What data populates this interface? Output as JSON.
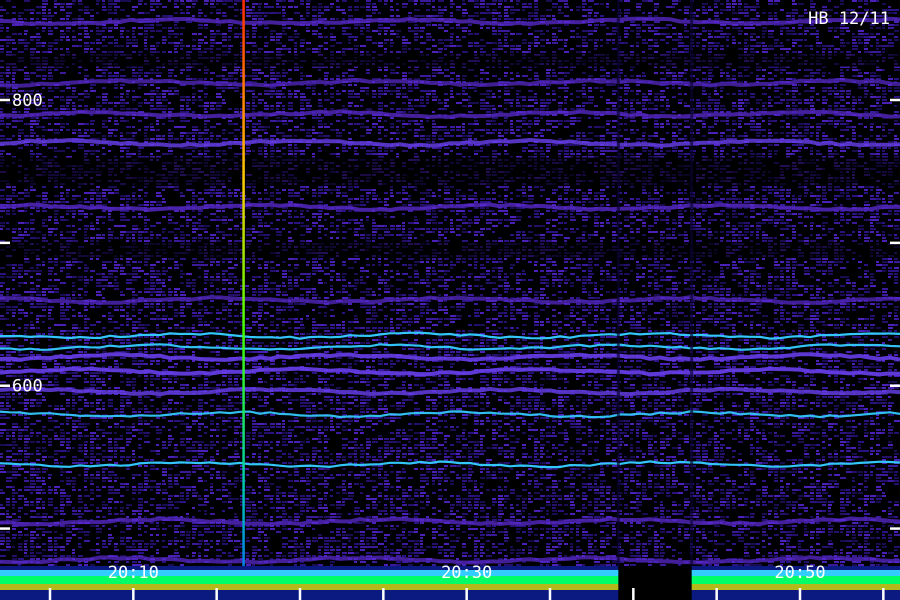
{
  "chart_data": {
    "type": "heatmap",
    "station": "HB 12/11",
    "y_axis": {
      "range": [
        450,
        870
      ],
      "ticks": [
        500,
        600,
        700,
        800
      ],
      "labels": [
        {
          "value": 800,
          "text": "800"
        },
        {
          "value": 600,
          "text": "600"
        }
      ]
    },
    "x_axis": {
      "range_minutes": [
        1202,
        1256
      ],
      "minor_tick_step": 5,
      "labels": [
        {
          "minute": 1210,
          "text": "20:10"
        },
        {
          "minute": 1230,
          "text": "20:30"
        },
        {
          "minute": 1250,
          "text": "20:50"
        }
      ]
    },
    "colors": {
      "background": "#000000",
      "noise": "#3a1a9a",
      "band": "#5a2ad0",
      "line": "#33ccff",
      "hot": "#00ff66"
    },
    "bands": [
      {
        "freq": 855,
        "strength": 0.45
      },
      {
        "freq": 812,
        "strength": 0.35
      },
      {
        "freq": 790,
        "strength": 0.45
      },
      {
        "freq": 770,
        "strength": 0.55
      },
      {
        "freq": 725,
        "strength": 0.5
      },
      {
        "freq": 660,
        "strength": 0.35
      },
      {
        "freq": 635,
        "strength": 0.95
      },
      {
        "freq": 627,
        "strength": 0.9
      },
      {
        "freq": 620,
        "strength": 0.7
      },
      {
        "freq": 610,
        "strength": 0.75
      },
      {
        "freq": 596,
        "strength": 0.55
      },
      {
        "freq": 580,
        "strength": 0.85
      },
      {
        "freq": 545,
        "strength": 0.95
      },
      {
        "freq": 505,
        "strength": 0.45
      },
      {
        "freq": 478,
        "strength": 0.4
      }
    ],
    "events": [
      {
        "minute": 1216.6,
        "kind": "vertical-burst"
      },
      {
        "minute": 1239.1,
        "kind": "quiet-gap-start"
      },
      {
        "minute": 1243.5,
        "kind": "quiet-gap-end"
      }
    ]
  }
}
